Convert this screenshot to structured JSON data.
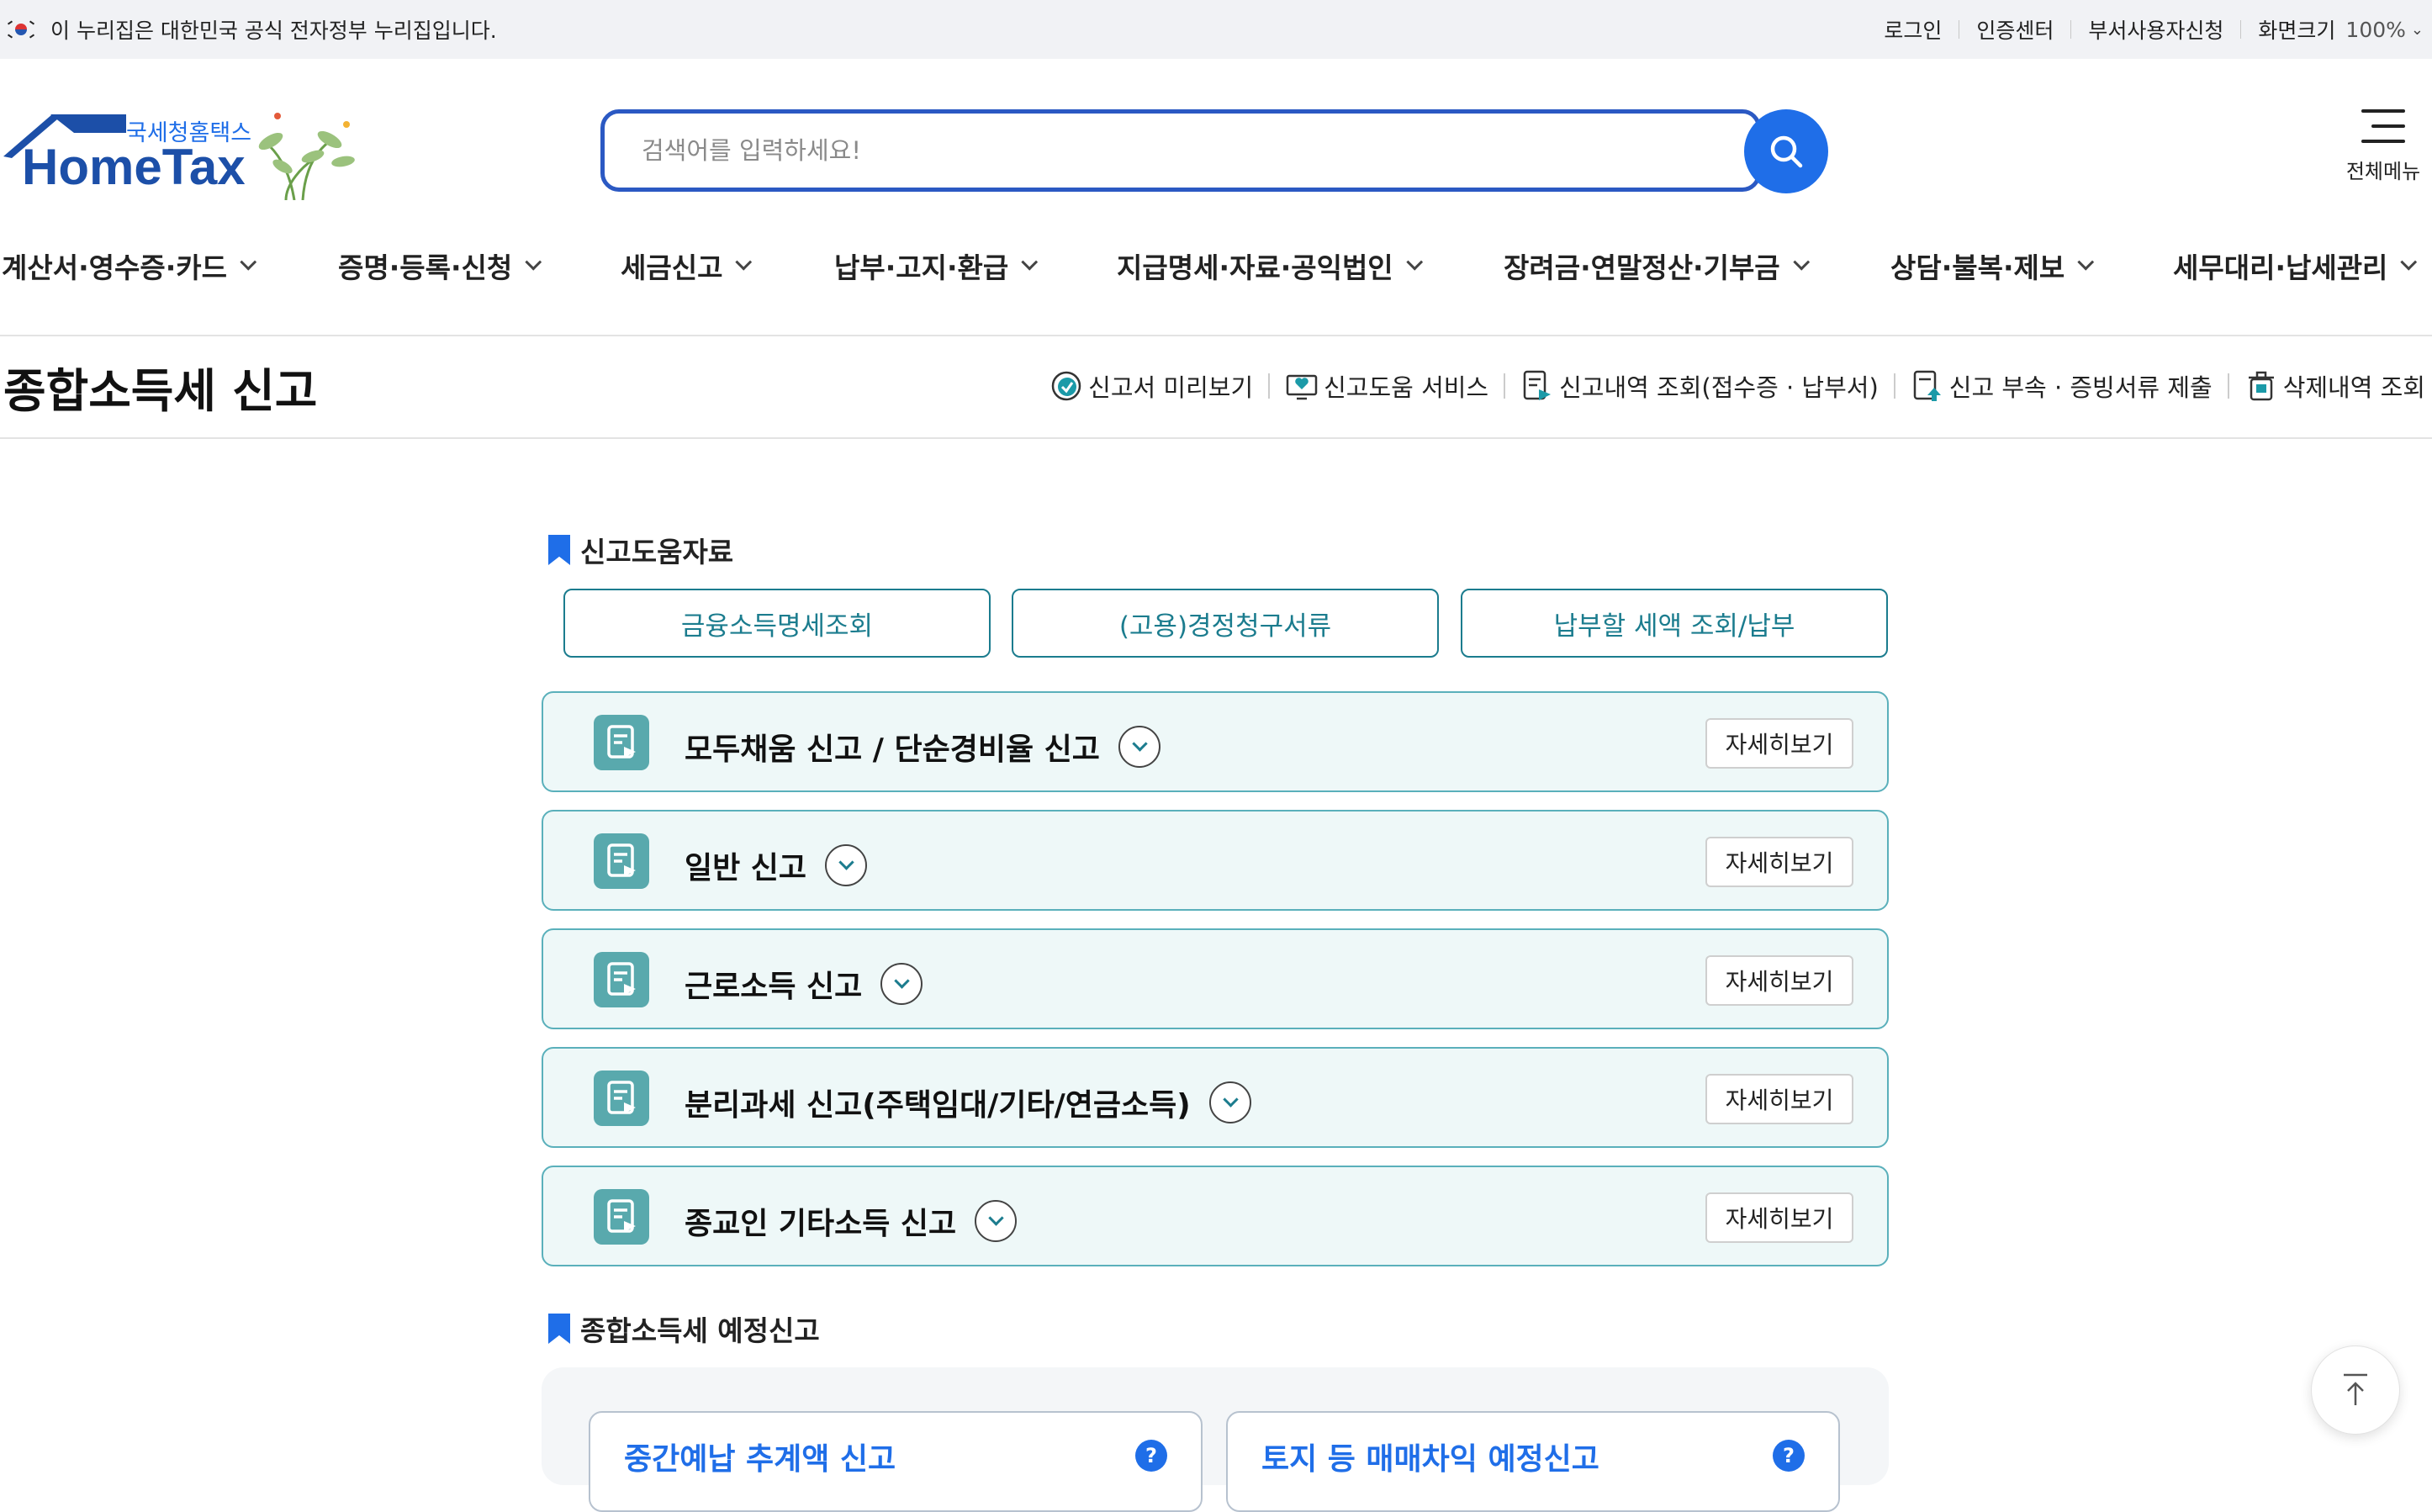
{
  "gov_bar": {
    "notice": "이 누리집은 대한민국 공식 전자정부 누리집입니다.",
    "login": "로그인",
    "cert_center": "인증센터",
    "dept_user": "부서사용자신청",
    "zoom_label": "화면크기",
    "zoom_value": "100%"
  },
  "logo": {
    "sub": "국세청홈택스",
    "main": "HomeTax"
  },
  "search": {
    "placeholder": "검색어를 입력하세요!"
  },
  "menu_all": {
    "label": "전체메뉴"
  },
  "nav": {
    "items": [
      "계산서·영수증·카드",
      "증명·등록·신청",
      "세금신고",
      "납부·고지·환급",
      "지급명세·자료·공익법인",
      "장려금·연말정산·기부금",
      "상담·불복·제보",
      "세무대리·납세관리"
    ]
  },
  "page": {
    "title": "종합소득세 신고",
    "quick": [
      "신고서 미리보기",
      "신고도움 서비스",
      "신고내역 조회(접수증 · 납부서)",
      "신고 부속 · 증빙서류 제출",
      "삭제내역 조회"
    ]
  },
  "help_section": {
    "title": "신고도움자료",
    "buttons": [
      "금융소득명세조회",
      "(고용)경정청구서류",
      "납부할 세액 조회/납부"
    ]
  },
  "panels": {
    "detail_label": "자세히보기",
    "items": [
      "모두채움 신고 / 단순경비율 신고",
      "일반 신고",
      "근로소득 신고",
      "분리과세 신고(주택임대/기타/연금소득)",
      "종교인 기타소득 신고"
    ]
  },
  "estimate_section": {
    "title": "종합소득세 예정신고",
    "cards": [
      "중간예납 추계액 신고",
      "토지 등 매매차익 예정신고"
    ],
    "help_glyph": "?"
  },
  "colors": {
    "accent": "#1f6ee8",
    "teal": "#1b7c8e",
    "panel_bg": "#eef8f8",
    "panel_border": "#5ab0bb"
  }
}
